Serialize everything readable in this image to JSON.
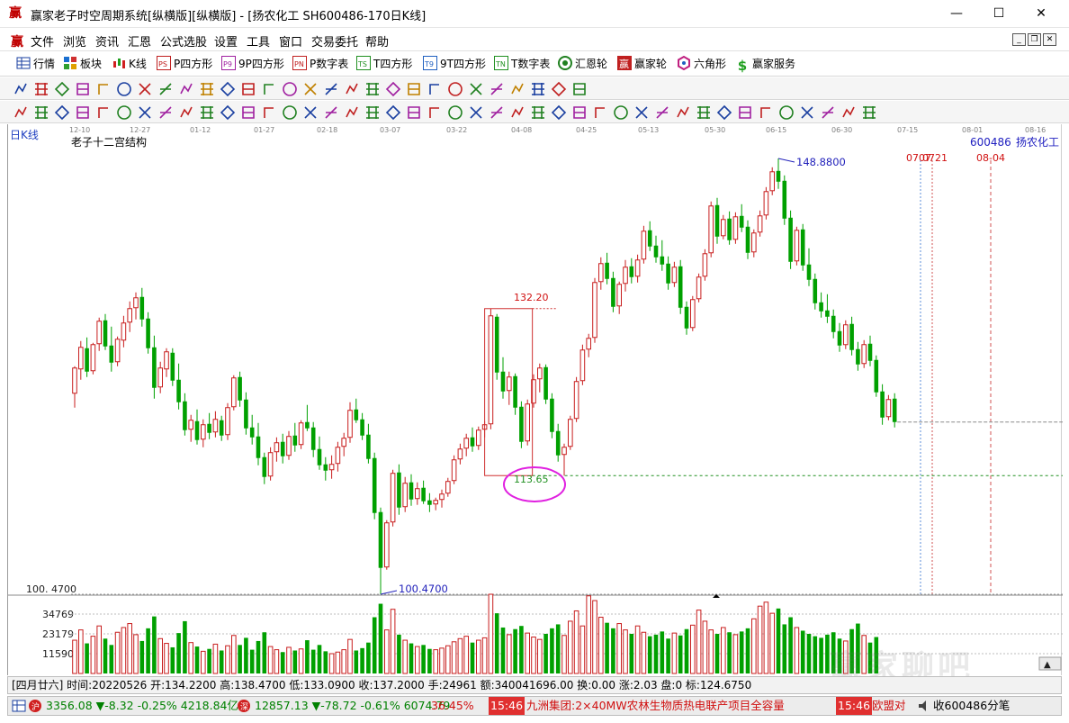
{
  "window": {
    "title": "赢家老子时空周期系统[纵横版][纵横版] - [扬农化工  SH600486-170日K线]",
    "minimize": "—",
    "maximize": "☐",
    "close": "✕"
  },
  "menu": {
    "items": [
      "文件",
      "浏览",
      "资讯",
      "汇恩",
      "公式选股",
      "设置",
      "工具",
      "窗口",
      "交易委托",
      "帮助"
    ]
  },
  "toolbar1": {
    "items": [
      "行情",
      "板块",
      "K线",
      "P四方形",
      "9P四方形",
      "P数字表",
      "T四方形",
      "9T四方形",
      "T数字表",
      "汇恩轮",
      "赢家轮",
      "六角形",
      "赢家服务"
    ]
  },
  "colors": {
    "up": "#c81e1e",
    "down": "#00a000",
    "annotation_blue": "#2222bb",
    "highlight_ellipse": "#e020e0"
  },
  "chart": {
    "period_label": "日K线",
    "indicator_title": "老子十二宫结构",
    "stock_code": "600486",
    "stock_name": "扬农化工",
    "date_ticks": [
      "12-10",
      "12-27",
      "01-12",
      "01-27",
      "02-18",
      "03-07",
      "03-22",
      "04-08",
      "04-25",
      "05-13",
      "05-30",
      "06-15",
      "06-30",
      "07-15",
      "08-01",
      "08-16"
    ],
    "high_label": "148.8800",
    "low_label": "100.4700",
    "low_axis_label": "100. 4700",
    "box_top_label": "132.20",
    "box_bottom_label": "113.65",
    "future_labels": [
      "0707",
      "0721",
      "08-04"
    ],
    "volume_ticks": [
      "34769",
      "23179",
      "11590"
    ]
  },
  "chart_data": {
    "type": "candlestick",
    "title": "老子十二宫结构",
    "price_high": 148.88,
    "price_low": 100.47,
    "box_high": 132.2,
    "box_low": 113.65,
    "volume_ticks": [
      34769,
      23179,
      11590
    ],
    "ohlc": [
      [
        122.8,
        125.8,
        121.2,
        125.6
      ],
      [
        125.5,
        128.6,
        124.3,
        127.9
      ],
      [
        127.8,
        129.0,
        124.6,
        125.2
      ],
      [
        125.3,
        128.4,
        124.9,
        128.2
      ],
      [
        128.3,
        131.2,
        127.5,
        130.8
      ],
      [
        130.9,
        131.6,
        127.6,
        128.0
      ],
      [
        128.1,
        130.2,
        125.2,
        126.2
      ],
      [
        126.3,
        129.1,
        125.8,
        128.8
      ],
      [
        128.7,
        131.4,
        127.9,
        130.6
      ],
      [
        130.7,
        133.0,
        129.6,
        132.2
      ],
      [
        132.3,
        134.0,
        131.0,
        133.4
      ],
      [
        133.5,
        134.5,
        130.2,
        131.0
      ],
      [
        131.1,
        131.8,
        127.2,
        127.8
      ],
      [
        127.9,
        129.2,
        122.2,
        123.4
      ],
      [
        123.5,
        126.3,
        122.8,
        125.6
      ],
      [
        125.5,
        127.8,
        124.6,
        127.4
      ],
      [
        127.3,
        127.8,
        123.6,
        124.2
      ],
      [
        124.3,
        126.1,
        121.0,
        121.8
      ],
      [
        121.9,
        122.8,
        118.1,
        118.7
      ],
      [
        118.8,
        120.4,
        117.4,
        119.8
      ],
      [
        119.7,
        121.0,
        117.1,
        117.6
      ],
      [
        117.7,
        119.9,
        116.8,
        119.3
      ],
      [
        119.4,
        120.6,
        117.7,
        118.4
      ],
      [
        118.5,
        120.8,
        117.9,
        119.9
      ],
      [
        119.8,
        120.3,
        117.5,
        118.1
      ],
      [
        118.2,
        121.7,
        117.6,
        121.2
      ],
      [
        121.3,
        124.8,
        120.9,
        124.5
      ],
      [
        124.6,
        125.2,
        121.3,
        122.0
      ],
      [
        122.1,
        122.9,
        118.2,
        118.9
      ],
      [
        119.0,
        120.4,
        117.1,
        117.9
      ],
      [
        118.0,
        119.5,
        114.8,
        115.6
      ],
      [
        115.7,
        116.2,
        112.7,
        113.5
      ],
      [
        113.6,
        116.8,
        113.1,
        116.2
      ],
      [
        116.3,
        117.9,
        115.2,
        117.3
      ],
      [
        117.4,
        118.3,
        115.0,
        115.8
      ],
      [
        115.9,
        118.6,
        115.4,
        118.0
      ],
      [
        118.1,
        119.5,
        116.3,
        117.0
      ],
      [
        117.1,
        119.8,
        116.6,
        119.5
      ],
      [
        119.6,
        121.5,
        118.6,
        118.9
      ],
      [
        119.0,
        119.6,
        115.7,
        116.5
      ],
      [
        116.6,
        118.0,
        114.3,
        114.8
      ],
      [
        114.9,
        115.7,
        113.1,
        114.2
      ],
      [
        114.3,
        115.9,
        113.3,
        114.9
      ],
      [
        115.0,
        117.4,
        114.1,
        116.8
      ],
      [
        116.9,
        118.4,
        115.8,
        117.8
      ],
      [
        117.9,
        121.8,
        117.3,
        120.9
      ],
      [
        121.0,
        122.2,
        119.5,
        119.8
      ],
      [
        119.9,
        120.6,
        117.6,
        118.1
      ],
      [
        118.2,
        119.4,
        115.0,
        115.5
      ],
      [
        115.6,
        116.2,
        108.8,
        109.5
      ],
      [
        109.6,
        110.1,
        100.47,
        103.4
      ],
      [
        103.5,
        108.7,
        103.2,
        108.4
      ],
      [
        108.5,
        114.3,
        108.0,
        113.9
      ],
      [
        114.0,
        114.9,
        109.3,
        110.1
      ],
      [
        110.2,
        113.5,
        109.6,
        112.8
      ],
      [
        112.9,
        113.8,
        110.3,
        111.0
      ],
      [
        111.1,
        112.9,
        110.4,
        112.2
      ],
      [
        112.3,
        113.1,
        110.5,
        110.8
      ],
      [
        110.9,
        111.7,
        109.6,
        110.4
      ],
      [
        110.5,
        111.2,
        109.8,
        110.9
      ],
      [
        111.0,
        112.1,
        110.1,
        111.6
      ],
      [
        111.7,
        113.4,
        111.3,
        113.0
      ],
      [
        113.1,
        115.9,
        112.7,
        115.4
      ],
      [
        115.5,
        117.2,
        114.9,
        116.6
      ],
      [
        116.7,
        118.3,
        115.8,
        117.8
      ],
      [
        117.9,
        119.0,
        116.3,
        116.9
      ],
      [
        117.0,
        119.1,
        116.5,
        118.7
      ],
      [
        118.8,
        119.7,
        117.9,
        119.3
      ],
      [
        119.4,
        132.2,
        118.8,
        131.4
      ],
      [
        131.3,
        131.6,
        124.3,
        125.1
      ],
      [
        125.2,
        126.8,
        122.2,
        123.0
      ],
      [
        123.1,
        125.2,
        121.5,
        124.6
      ],
      [
        124.7,
        125.0,
        120.4,
        121.2
      ],
      [
        121.3,
        121.9,
        116.7,
        117.4
      ],
      [
        117.5,
        122.1,
        117.0,
        121.6
      ],
      [
        121.7,
        124.9,
        121.2,
        124.3
      ],
      [
        124.4,
        126.1,
        122.9,
        125.6
      ],
      [
        125.7,
        126.0,
        121.6,
        122.1
      ],
      [
        122.2,
        122.8,
        117.8,
        118.5
      ],
      [
        118.6,
        119.4,
        115.2,
        115.9
      ],
      [
        116.0,
        117.2,
        113.65,
        116.8
      ],
      [
        116.9,
        120.3,
        116.5,
        119.9
      ],
      [
        120.0,
        124.6,
        119.6,
        124.1
      ],
      [
        124.2,
        128.2,
        123.7,
        127.6
      ],
      [
        127.7,
        129.4,
        126.8,
        128.9
      ],
      [
        129.0,
        135.6,
        128.4,
        135.1
      ],
      [
        135.2,
        137.9,
        134.3,
        137.2
      ],
      [
        137.3,
        138.4,
        134.9,
        135.5
      ],
      [
        135.6,
        136.3,
        131.8,
        132.4
      ],
      [
        132.5,
        135.2,
        131.6,
        134.9
      ],
      [
        135.0,
        137.6,
        134.1,
        136.8
      ],
      [
        136.9,
        137.8,
        135.0,
        135.7
      ],
      [
        135.8,
        138.2,
        135.1,
        137.6
      ],
      [
        137.7,
        141.4,
        137.2,
        140.8
      ],
      [
        140.9,
        141.9,
        138.6,
        139.1
      ],
      [
        139.2,
        140.3,
        137.3,
        137.9
      ],
      [
        138.0,
        139.8,
        136.4,
        137.1
      ],
      [
        137.2,
        138.0,
        134.3,
        135.0
      ],
      [
        135.1,
        137.4,
        134.6,
        136.8
      ],
      [
        136.9,
        137.6,
        131.6,
        132.3
      ],
      [
        132.4,
        133.0,
        129.3,
        130.0
      ],
      [
        130.1,
        133.6,
        129.7,
        133.2
      ],
      [
        133.3,
        136.1,
        132.9,
        135.7
      ],
      [
        135.8,
        138.8,
        135.3,
        138.3
      ],
      [
        138.4,
        144.1,
        137.9,
        143.6
      ],
      [
        143.7,
        144.5,
        139.4,
        140.2
      ],
      [
        140.3,
        142.6,
        139.9,
        142.1
      ],
      [
        142.2,
        143.0,
        139.3,
        139.8
      ],
      [
        139.9,
        142.9,
        139.4,
        142.4
      ],
      [
        142.5,
        143.8,
        140.7,
        141.2
      ],
      [
        141.3,
        142.0,
        137.7,
        138.4
      ],
      [
        138.5,
        141.0,
        137.9,
        140.6
      ],
      [
        140.7,
        143.1,
        140.2,
        142.5
      ],
      [
        142.6,
        145.7,
        142.1,
        145.2
      ],
      [
        145.3,
        147.9,
        144.8,
        147.4
      ],
      [
        147.5,
        148.88,
        145.5,
        146.3
      ],
      [
        146.4,
        147.0,
        141.5,
        142.2
      ],
      [
        142.3,
        143.1,
        136.6,
        137.4
      ],
      [
        137.5,
        141.3,
        137.0,
        140.9
      ],
      [
        141.0,
        141.6,
        136.4,
        137.0
      ],
      [
        137.1,
        138.9,
        134.7,
        135.4
      ],
      [
        135.5,
        136.1,
        132.1,
        132.8
      ],
      [
        132.9,
        134.0,
        131.2,
        131.9
      ],
      [
        132.0,
        133.8,
        130.6,
        131.3
      ],
      [
        131.4,
        132.1,
        128.9,
        129.6
      ],
      [
        129.7,
        130.6,
        127.4,
        128.1
      ],
      [
        128.2,
        130.9,
        127.7,
        130.4
      ],
      [
        130.5,
        131.3,
        127.0,
        127.6
      ],
      [
        127.7,
        128.5,
        125.3,
        126.0
      ],
      [
        126.1,
        128.7,
        125.6,
        128.2
      ],
      [
        128.3,
        129.2,
        125.8,
        126.4
      ],
      [
        126.5,
        127.0,
        122.4,
        122.9
      ],
      [
        123.0,
        123.8,
        119.3,
        120.1
      ],
      [
        120.2,
        122.6,
        119.8,
        122.1
      ],
      [
        122.2,
        122.8,
        119.0,
        119.6
      ]
    ],
    "volumes": [
      0.42,
      0.55,
      0.38,
      0.47,
      0.6,
      0.44,
      0.36,
      0.52,
      0.58,
      0.63,
      0.49,
      0.41,
      0.57,
      0.72,
      0.44,
      0.38,
      0.33,
      0.51,
      0.66,
      0.39,
      0.34,
      0.28,
      0.31,
      0.37,
      0.29,
      0.35,
      0.48,
      0.36,
      0.45,
      0.3,
      0.41,
      0.52,
      0.34,
      0.3,
      0.27,
      0.33,
      0.29,
      0.31,
      0.42,
      0.3,
      0.36,
      0.28,
      0.25,
      0.27,
      0.3,
      0.43,
      0.29,
      0.32,
      0.39,
      0.71,
      0.88,
      0.55,
      0.81,
      0.49,
      0.42,
      0.38,
      0.34,
      0.36,
      0.31,
      0.3,
      0.32,
      0.35,
      0.4,
      0.44,
      0.47,
      0.39,
      0.42,
      0.45,
      1.0,
      0.76,
      0.58,
      0.49,
      0.56,
      0.6,
      0.51,
      0.46,
      0.43,
      0.5,
      0.57,
      0.62,
      0.48,
      0.66,
      0.79,
      0.6,
      0.98,
      0.92,
      0.71,
      0.64,
      0.57,
      0.63,
      0.55,
      0.5,
      0.6,
      0.52,
      0.47,
      0.49,
      0.53,
      0.44,
      0.51,
      0.48,
      0.56,
      0.61,
      0.8,
      0.66,
      0.55,
      0.5,
      0.58,
      0.52,
      0.49,
      0.53,
      0.57,
      0.69,
      0.85,
      0.9,
      0.76,
      0.82,
      0.62,
      0.71,
      0.58,
      0.54,
      0.5,
      0.47,
      0.45,
      0.49,
      0.52,
      0.44,
      0.41,
      0.56,
      0.63,
      0.48,
      0.39,
      0.46
    ]
  },
  "infobar": {
    "text": "[四月廿六] 时间:20220526 开:134.2200 高:138.4700 低:133.0900 收:137.2000 手:24961 额:340041696.00 换:0.00 涨:2.03 盘:0 标:124.6750"
  },
  "statusbar": {
    "sh_index": "3356.08 ▼-8.32 -0.25% 4218.84亿",
    "sz_index": "12857.13 ▼-78.72 -0.61% 6074.79",
    "pct": "36.45%",
    "news_time": "15:46",
    "news_text": "九洲集团:2×40MW农林生物质热电联产项目全容量",
    "news_time2": "15:46",
    "news_text2": "欧盟对",
    "code_tail": "收600486分笔"
  },
  "watermark": "赢家聊吧"
}
